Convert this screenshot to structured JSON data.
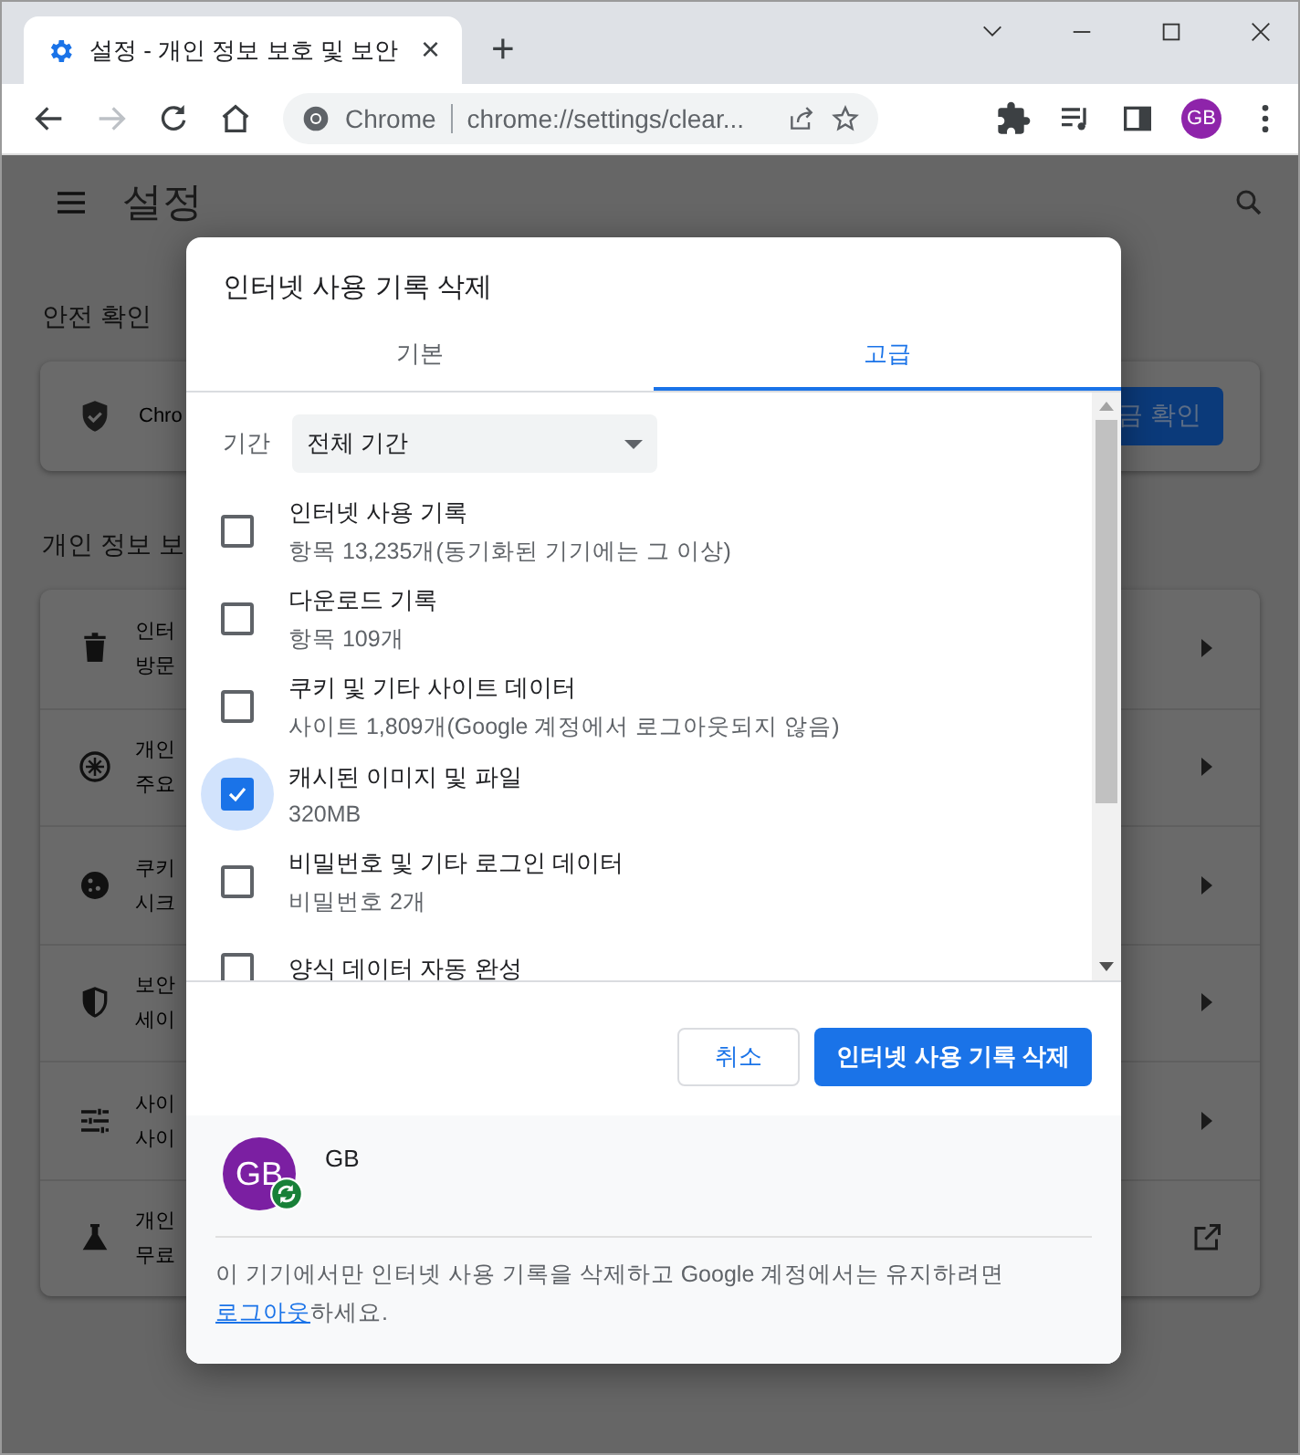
{
  "browser": {
    "tab": {
      "title": "설정 - 개인 정보 보호 및 보안",
      "close": "×"
    },
    "new_tab": "+",
    "omnibox": {
      "site": "Chrome",
      "url": "chrome://settings/clear..."
    },
    "profile": "GB"
  },
  "page": {
    "title": "설정",
    "safety_heading": "안전 확인",
    "safety_text": "Chro",
    "safety_button": "금 확인",
    "privacy_heading": "개인 정보 보",
    "rows": [
      {
        "kind": "arrow",
        "title": "인터",
        "subtitle": "방문"
      },
      {
        "kind": "arrow",
        "title": "개인",
        "subtitle": "주요"
      },
      {
        "kind": "arrow",
        "title": "쿠키",
        "subtitle": "시크"
      },
      {
        "kind": "arrow",
        "title": "보안",
        "subtitle": "세이"
      },
      {
        "kind": "arrow",
        "title": "사이",
        "subtitle": "사이"
      },
      {
        "kind": "external",
        "title": "개인",
        "subtitle": "무료"
      }
    ]
  },
  "dialog": {
    "title": "인터넷 사용 기록 삭제",
    "tabs": [
      {
        "label": "기본",
        "selected": false
      },
      {
        "label": "고급",
        "selected": true
      }
    ],
    "period": {
      "label": "기간",
      "value": "전체 기간"
    },
    "items": [
      {
        "title": "인터넷 사용 기록",
        "subtitle": "항목 13,235개(동기화된 기기에는 그 이상)",
        "checked": false
      },
      {
        "title": "다운로드 기록",
        "subtitle": "항목 109개",
        "checked": false
      },
      {
        "title": "쿠키 및 기타 사이트 데이터",
        "subtitle": "사이트 1,809개(Google 계정에서 로그아웃되지 않음)",
        "checked": false
      },
      {
        "title": "캐시된 이미지 및 파일",
        "subtitle": "320MB",
        "checked": true
      },
      {
        "title": "비밀번호 및 기타 로그인 데이터",
        "subtitle": "비밀번호 2개",
        "checked": false
      },
      {
        "title": "양식 데이터 자동 완성",
        "checked": false
      }
    ],
    "buttons": {
      "cancel": "취소",
      "confirm": "인터넷 사용 기록 삭제"
    },
    "account": {
      "avatar": "GB",
      "name": "GB"
    },
    "note": {
      "text": "이 기기에서만 인터넷 사용 기록을 삭제하고 Google 계정에서는 유지하려면 ",
      "link": "로그아웃",
      "after": "하세요."
    }
  }
}
